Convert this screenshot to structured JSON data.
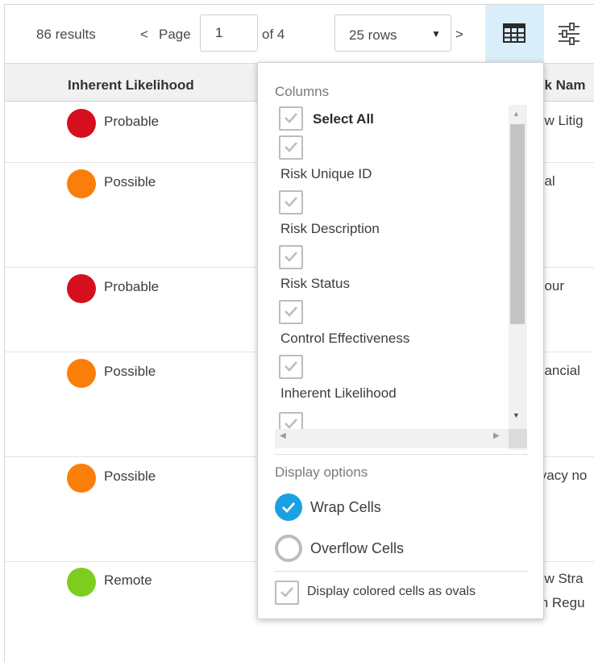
{
  "toolbar": {
    "results": "86 results",
    "prev": "<",
    "page_word": "Page",
    "page_value": "1",
    "page_of": "of 4",
    "rows_label": "25 rows",
    "rows_caret": "▼",
    "next": ">"
  },
  "table": {
    "headers": {
      "likelihood": "Inherent Likelihood",
      "name": "sk Nam"
    },
    "rows": [
      {
        "likelihood": "Probable",
        "color": "#d60f1f",
        "name": [
          "ew Litig"
        ]
      },
      {
        "likelihood": "Possible",
        "color": "#fa7f0a",
        "name": [
          "gal"
        ]
      },
      {
        "likelihood": "Probable",
        "color": "#d60f1f",
        "name": [
          "bour"
        ]
      },
      {
        "likelihood": "Possible",
        "color": "#fa7f0a",
        "name": [
          "nancial"
        ]
      },
      {
        "likelihood": "Possible",
        "color": "#fa7f0a",
        "name": [
          "ivacy no"
        ]
      },
      {
        "likelihood": "Remote",
        "color": "#7ccd1e",
        "name": [
          "ew Stra",
          "th Regu"
        ]
      }
    ]
  },
  "popover": {
    "columns_title": "Columns",
    "select_all": "Select All",
    "columns": [
      "Risk Unique ID",
      "Risk Description",
      "Risk Status",
      "Control Effectiveness",
      "Inherent Likelihood"
    ],
    "display_title": "Display options",
    "wrap_cells": "Wrap Cells",
    "overflow_cells": "Overflow Cells",
    "ovals_label": "Display colored cells as ovals"
  },
  "colors": {
    "accent": "#1ba1e2",
    "active_button_bg": "#d9eef9"
  }
}
